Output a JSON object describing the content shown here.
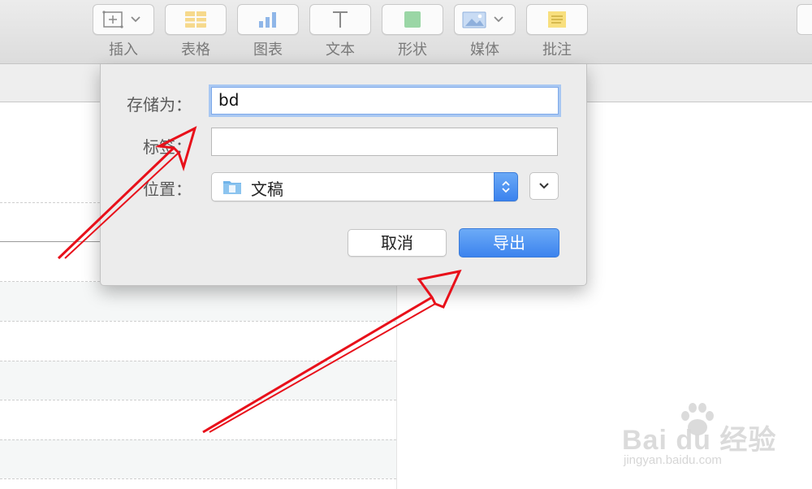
{
  "toolbar": {
    "items": [
      {
        "label": "插入",
        "icon": "insert-icon"
      },
      {
        "label": "表格",
        "icon": "table-icon"
      },
      {
        "label": "图表",
        "icon": "chart-icon"
      },
      {
        "label": "文本",
        "icon": "text-icon"
      },
      {
        "label": "形状",
        "icon": "shape-icon"
      },
      {
        "label": "媒体",
        "icon": "media-icon"
      },
      {
        "label": "批注",
        "icon": "comment-icon"
      }
    ]
  },
  "dialog": {
    "save_as_label": "存储为：",
    "save_as_value": "bd",
    "tags_label": "标签：",
    "tags_value": "",
    "location_label": "位置：",
    "location_value": "文稿",
    "cancel_label": "取消",
    "export_label": "导出"
  },
  "colors": {
    "accent": "#3c83ee",
    "annotation_arrow": "#e8101a",
    "folder": "#6fb3e9"
  },
  "watermark": {
    "brand": "Bai du 经验",
    "url": "jingyan.baidu.com"
  }
}
